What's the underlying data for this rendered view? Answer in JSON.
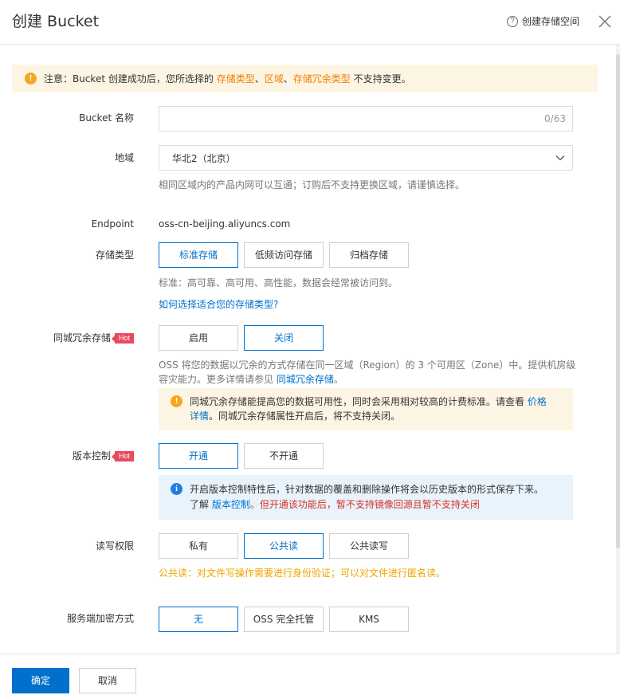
{
  "header": {
    "title": "创建 Bucket",
    "help_icon": "?",
    "help_label": "创建存储空间"
  },
  "notice": {
    "icon": "!",
    "prefix": "注意：Bucket 创建成功后，您所选择的 ",
    "hl1": "存储类型",
    "sep1": "、",
    "hl2": "区域",
    "sep2": "、",
    "hl3": "存储冗余类型",
    "suffix": " 不支持变更。"
  },
  "bucket_name": {
    "label": "Bucket 名称",
    "value": "",
    "counter": "0/63"
  },
  "region": {
    "label": "地域",
    "value": "华北2（北京）",
    "hint": "相同区域内的产品内网可以互通；订购后不支持更换区域，请谨慎选择。"
  },
  "endpoint": {
    "label": "Endpoint",
    "value": "oss-cn-beijing.aliyuncs.com"
  },
  "storage_class": {
    "label": "存储类型",
    "options": [
      "标准存储",
      "低频访问存储",
      "归档存储"
    ],
    "selected": "标准存储",
    "hint": "标准：高可靠、高可用、高性能，数据会经常被访问到。",
    "link": "如何选择适合您的存储类型?"
  },
  "zrs": {
    "label": "同城冗余存储",
    "badge": "Hot",
    "options": [
      "启用",
      "关闭"
    ],
    "selected": "关闭",
    "hint_line1": "OSS 将您的数据以冗余的方式存储在同一区域（Region）的 3 个可用区（Zone）中。提供机房级",
    "hint_line2": "容灾能力。更多详情请参见 ",
    "hint_link": "同城冗余存储",
    "hint_end": "。",
    "warn_icon": "!",
    "warn_text1": "同城冗余存储能提高您的数据可用性，同时会采用相对较高的计费标准。请查看 ",
    "warn_link1": "价格",
    "warn_link2": "详情",
    "warn_text2": "。同城冗余存储属性开启后，将不支持关闭。"
  },
  "versioning": {
    "label": "版本控制",
    "badge": "Hot",
    "options": [
      "开通",
      "不开通"
    ],
    "selected": "开通",
    "info_icon": "i",
    "info_text1": "开启版本控制特性后，针对数据的覆盖和删除操作将会以历史版本的形式保存下来。",
    "info_prefix": "了解 ",
    "info_link": "版本控制",
    "info_red": "。但开通该功能后，暂不支持镜像回源且暂不支持关闭"
  },
  "acl": {
    "label": "读写权限",
    "options": [
      "私有",
      "公共读",
      "公共读写"
    ],
    "selected": "公共读",
    "warning": "公共读：对文件写操作需要进行身份验证；可以对文件进行匿名读。"
  },
  "encryption": {
    "label": "服务端加密方式",
    "options": [
      "无",
      "OSS 完全托管",
      "KMS"
    ],
    "selected": "无"
  },
  "footer": {
    "confirm": "确定",
    "cancel": "取消"
  },
  "colors": {
    "primary": "#0070cc",
    "warning_bg": "#fdf5e3",
    "info_bg": "#e8f3fc",
    "hot": "#e94b5f"
  }
}
